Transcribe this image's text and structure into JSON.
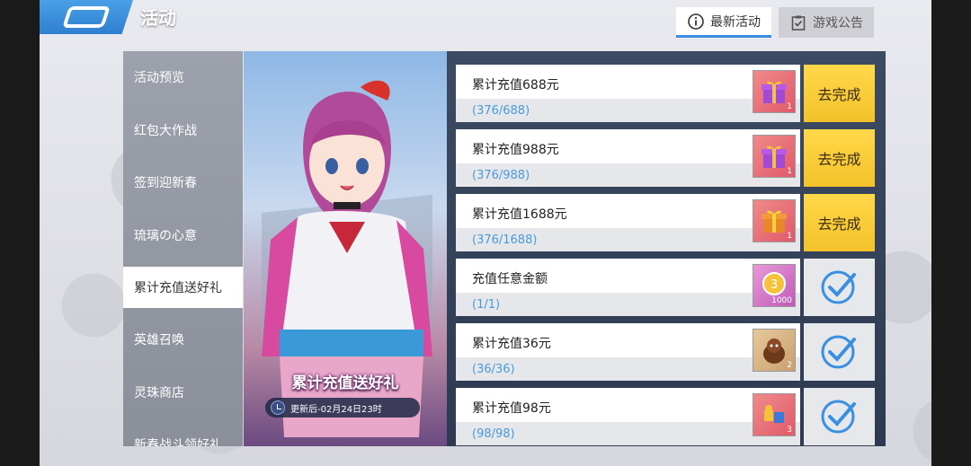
{
  "header": {
    "title": "活动",
    "back_icon": "back-arrow-icon"
  },
  "tabs": [
    {
      "label": "最新活动",
      "icon": "info-icon",
      "active": true
    },
    {
      "label": "游戏公告",
      "icon": "clipboard-check-icon",
      "active": false
    }
  ],
  "sidebar": {
    "items": [
      {
        "label": "活动预览"
      },
      {
        "label": "红包大作战"
      },
      {
        "label": "签到迎新春"
      },
      {
        "label": "琉璃の心意"
      },
      {
        "label": "累计充值送好礼",
        "active": true
      },
      {
        "label": "英雄召唤"
      },
      {
        "label": "灵珠商店"
      },
      {
        "label": "新春战斗领好礼"
      }
    ]
  },
  "banner": {
    "title": "累计充值送好礼",
    "time": "更新后-02月24日23时"
  },
  "tasks": [
    {
      "name": "累计充值688元",
      "progress": "(376/688)",
      "reward_icon": "gift-box-icon",
      "reward_qty": "1",
      "reward_color": "red",
      "action": "去完成",
      "done": false
    },
    {
      "name": "累计充值988元",
      "progress": "(376/988)",
      "reward_icon": "gift-box-icon",
      "reward_qty": "1",
      "reward_color": "red",
      "action": "去完成",
      "done": false
    },
    {
      "name": "累计充值1688元",
      "progress": "(376/1688)",
      "reward_icon": "gift-box-icon",
      "reward_qty": "1",
      "reward_color": "red",
      "action": "去完成",
      "done": false
    },
    {
      "name": "充值任意金额",
      "progress": "(1/1)",
      "reward_icon": "coin-icon",
      "reward_qty": "1000",
      "reward_color": "pink",
      "action": "",
      "done": true
    },
    {
      "name": "累计充值36元",
      "progress": "(36/36)",
      "reward_icon": "doll-icon",
      "reward_qty": "2",
      "reward_color": "tan",
      "action": "",
      "done": true
    },
    {
      "name": "累计充值98元",
      "progress": "(98/98)",
      "reward_icon": "bag-icon",
      "reward_qty": "3",
      "reward_color": "red",
      "action": "",
      "done": true
    }
  ],
  "colors": {
    "accent_blue": "#3a8fe0",
    "action_yellow": "#f3c22a",
    "check_blue": "#3a8fe0"
  }
}
